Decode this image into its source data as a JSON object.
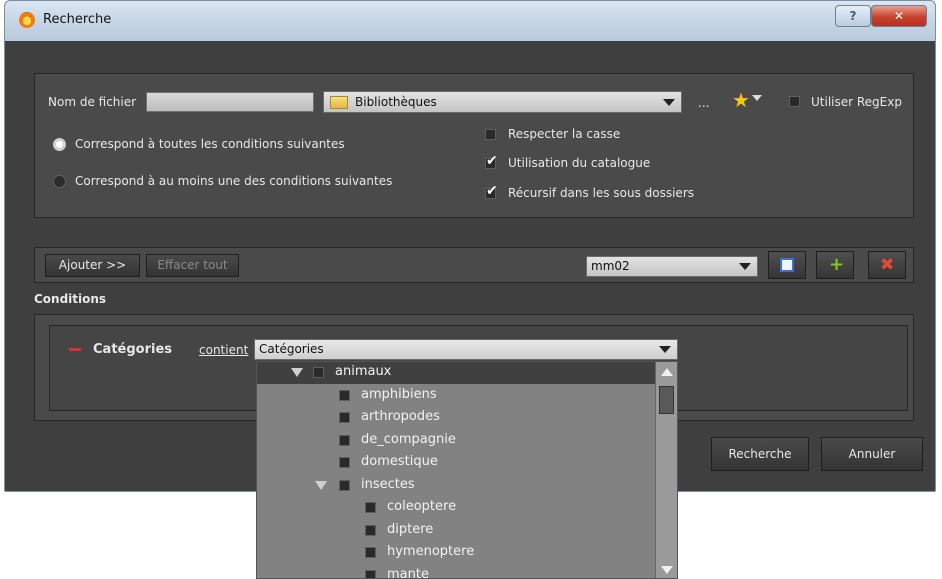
{
  "window": {
    "title": "Recherche"
  },
  "search": {
    "filename_label": "Nom de fichier",
    "filename_value": "",
    "location": "Bibliothèques",
    "ellipsis": "...",
    "regexp_label": "Utiliser RegExp",
    "match_all_label": "Correspond à toutes les conditions suivantes",
    "match_any_label": "Correspond à au moins une des conditions suivantes",
    "case_label": "Respecter la casse",
    "catalog_label": "Utilisation du catalogue",
    "recursive_label": "Récursif dans les sous dossiers"
  },
  "toolbar": {
    "add_label": "Ajouter >>",
    "clear_label": "Effacer tout",
    "preset_value": "mm02"
  },
  "conditions": {
    "header": "Conditions",
    "field_label": "Catégories",
    "operator_label": "contient",
    "value": "Catégories"
  },
  "dropdown": {
    "items": [
      {
        "label": "animaux"
      },
      {
        "label": "amphibiens"
      },
      {
        "label": "arthropodes"
      },
      {
        "label": "de_compagnie"
      },
      {
        "label": "domestique"
      },
      {
        "label": "insectes"
      },
      {
        "label": "coleoptere"
      },
      {
        "label": "diptere"
      },
      {
        "label": "hymenoptere"
      },
      {
        "label": "mante"
      }
    ]
  },
  "footer": {
    "search_label": "Recherche",
    "cancel_label": "Annuler"
  },
  "colors": {
    "accent_star": "#f5c518",
    "remove_red": "#d9342b",
    "add_green": "#7ccc1c"
  }
}
